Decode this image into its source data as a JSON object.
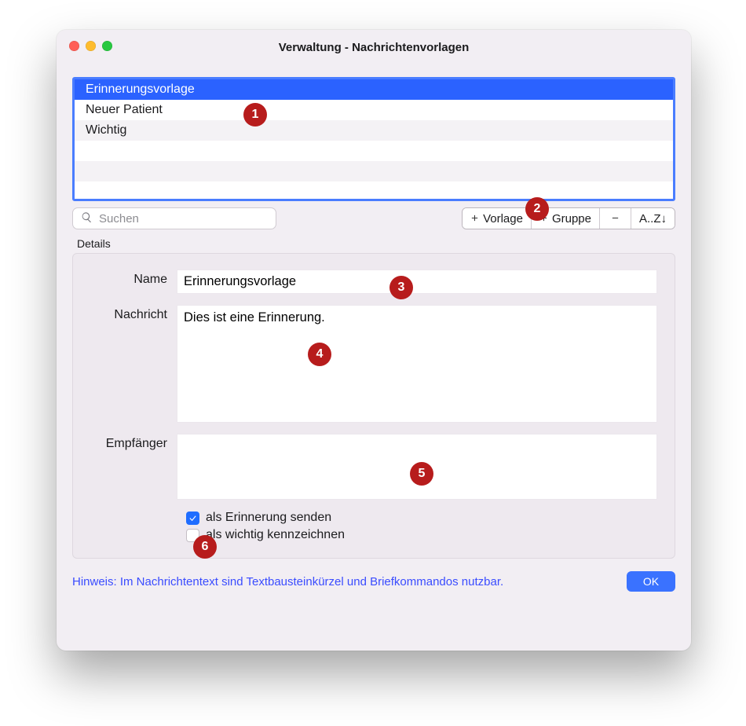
{
  "window": {
    "title": "Verwaltung - Nachrichtenvorlagen"
  },
  "list": {
    "items": [
      {
        "label": "Erinnerungsvorlage",
        "selected": true
      },
      {
        "label": "Neuer Patient",
        "selected": false
      },
      {
        "label": "Wichtig",
        "selected": false
      }
    ]
  },
  "toolbar": {
    "search_placeholder": "Suchen",
    "add_template_label": "Vorlage",
    "add_group_label": "Gruppe",
    "sort_label": "A..Z↓"
  },
  "details": {
    "section_label": "Details",
    "name_label": "Name",
    "name_value": "Erinnerungsvorlage",
    "message_label": "Nachricht",
    "message_value": "Dies ist eine Erinnerung.",
    "recipients_label": "Empfänger",
    "check_reminder_label": "als Erinnerung senden",
    "check_reminder_checked": true,
    "check_important_label": "als wichtig kennzeichnen",
    "check_important_checked": false
  },
  "footer": {
    "hint": "Hinweis: Im Nachrichtentext sind Textbausteinkürzel und Briefkommandos nutzbar.",
    "ok": "OK"
  },
  "annotations": {
    "b1": "1",
    "b2": "2",
    "b3": "3",
    "b4": "4",
    "b5": "5",
    "b6": "6"
  }
}
